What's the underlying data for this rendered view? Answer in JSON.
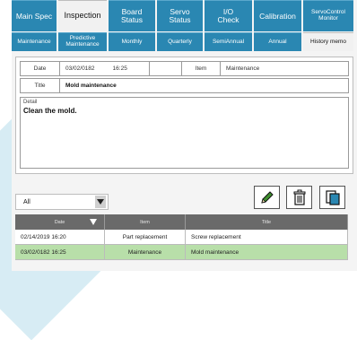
{
  "tabs_row1": [
    {
      "label": "Main Spec"
    },
    {
      "label": "Inspection",
      "active": true
    },
    {
      "label": "Board\nStatus"
    },
    {
      "label": "Servo\nStatus"
    },
    {
      "label": "I/O\nCheck"
    },
    {
      "label": "Calibration"
    },
    {
      "label": "ServoControl\nMonitor"
    }
  ],
  "tabs_row2": [
    {
      "label": "Maintenance"
    },
    {
      "label": "Predictive\nMaintenance"
    },
    {
      "label": "Monthly"
    },
    {
      "label": "Quarterly"
    },
    {
      "label": "SemiAnnual"
    },
    {
      "label": "Annual"
    },
    {
      "label": "History memo",
      "active": true
    }
  ],
  "record": {
    "date_label": "Date",
    "date_value": "03/02/0182",
    "time_value": "16:25",
    "item_label": "Item",
    "item_value": "Maintenance",
    "title_label": "Title",
    "title_value": "Mold maintenance",
    "detail_label": "Detail",
    "detail_text": "Clean the mold."
  },
  "filter": {
    "value": "All"
  },
  "icons": [
    "edit-pencil-icon",
    "delete-trash-icon",
    "copy-documents-icon"
  ],
  "table": {
    "headers": [
      "Date",
      "Item",
      "Title"
    ],
    "rows": [
      {
        "date": "02/14/2019  16:20",
        "item": "Part replacement",
        "title": "Screw replacement",
        "selected": false
      },
      {
        "date": "03/02/0182  16:25",
        "item": "Maintenance",
        "title": "Mold maintenance",
        "selected": true
      }
    ]
  },
  "colors": {
    "tab_bg": "#2a87b2",
    "selected_row": "#b8dfa9",
    "table_header": "#6a6a6a"
  }
}
